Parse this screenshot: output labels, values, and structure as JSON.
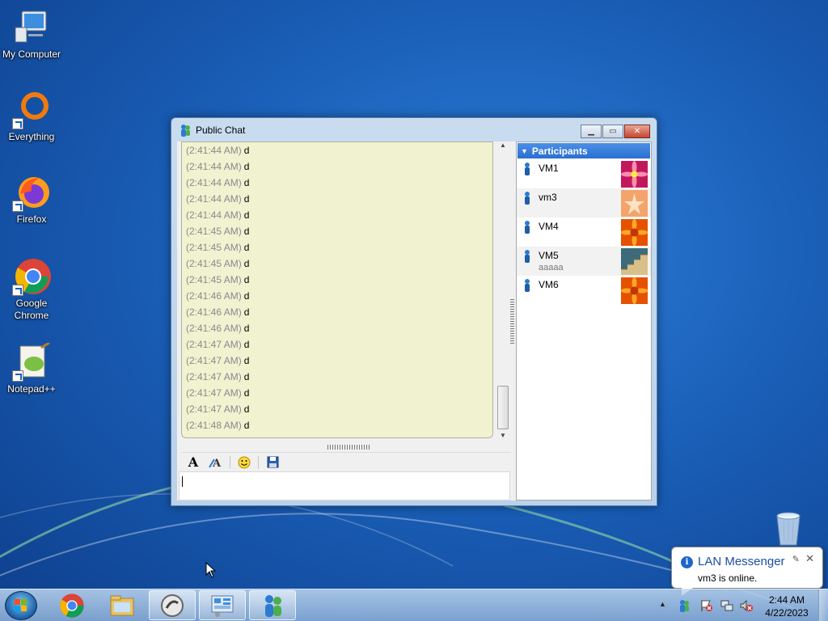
{
  "desktop": {
    "icons": [
      {
        "label": "My Computer"
      },
      {
        "label": "Everything"
      },
      {
        "label": "Firefox"
      },
      {
        "label": "Google Chrome"
      },
      {
        "label": "Notepad++"
      }
    ]
  },
  "chat_window": {
    "title": "Public Chat",
    "messages": [
      {
        "time": "(2:41:44 AM)",
        "text": "d"
      },
      {
        "time": "(2:41:44 AM)",
        "text": "d"
      },
      {
        "time": "(2:41:44 AM)",
        "text": "d"
      },
      {
        "time": "(2:41:44 AM)",
        "text": "d"
      },
      {
        "time": "(2:41:44 AM)",
        "text": "d"
      },
      {
        "time": "(2:41:45 AM)",
        "text": "d"
      },
      {
        "time": "(2:41:45 AM)",
        "text": "d"
      },
      {
        "time": "(2:41:45 AM)",
        "text": "d"
      },
      {
        "time": "(2:41:45 AM)",
        "text": "d"
      },
      {
        "time": "(2:41:46 AM)",
        "text": "d"
      },
      {
        "time": "(2:41:46 AM)",
        "text": "d"
      },
      {
        "time": "(2:41:46 AM)",
        "text": "d"
      },
      {
        "time": "(2:41:47 AM)",
        "text": "d"
      },
      {
        "time": "(2:41:47 AM)",
        "text": "d"
      },
      {
        "time": "(2:41:47 AM)",
        "text": "d"
      },
      {
        "time": "(2:41:47 AM)",
        "text": "d"
      },
      {
        "time": "(2:41:47 AM)",
        "text": "d"
      },
      {
        "time": "(2:41:48 AM)",
        "text": "d"
      }
    ],
    "toolbar": {
      "icons": [
        "font-icon",
        "font-color-icon",
        "smiley-icon",
        "save-icon"
      ]
    },
    "input_value": "",
    "participants": {
      "header": "Participants",
      "list": [
        {
          "name": "VM1",
          "status": "",
          "avatar": "pink-flower"
        },
        {
          "name": "vm3",
          "status": "",
          "avatar": "starfish"
        },
        {
          "name": "VM4",
          "status": "",
          "avatar": "orange-flower"
        },
        {
          "name": "VM5",
          "status": "aaaaa",
          "avatar": "stairs"
        },
        {
          "name": "VM6",
          "status": "",
          "avatar": "orange-flower"
        }
      ]
    }
  },
  "notification": {
    "title": "LAN Messenger",
    "body": "vm3 is online."
  },
  "taskbar": {
    "apps": [
      "chrome",
      "file-explorer",
      "app-circle",
      "control-panel",
      "lan-messenger"
    ],
    "clock": {
      "time": "2:44 AM",
      "date": "4/22/2023"
    }
  },
  "colors": {
    "chat_bg": "#f1f2d0",
    "participants_header": "#2b6fd0",
    "desktop_bg": "#1a5fb8"
  }
}
